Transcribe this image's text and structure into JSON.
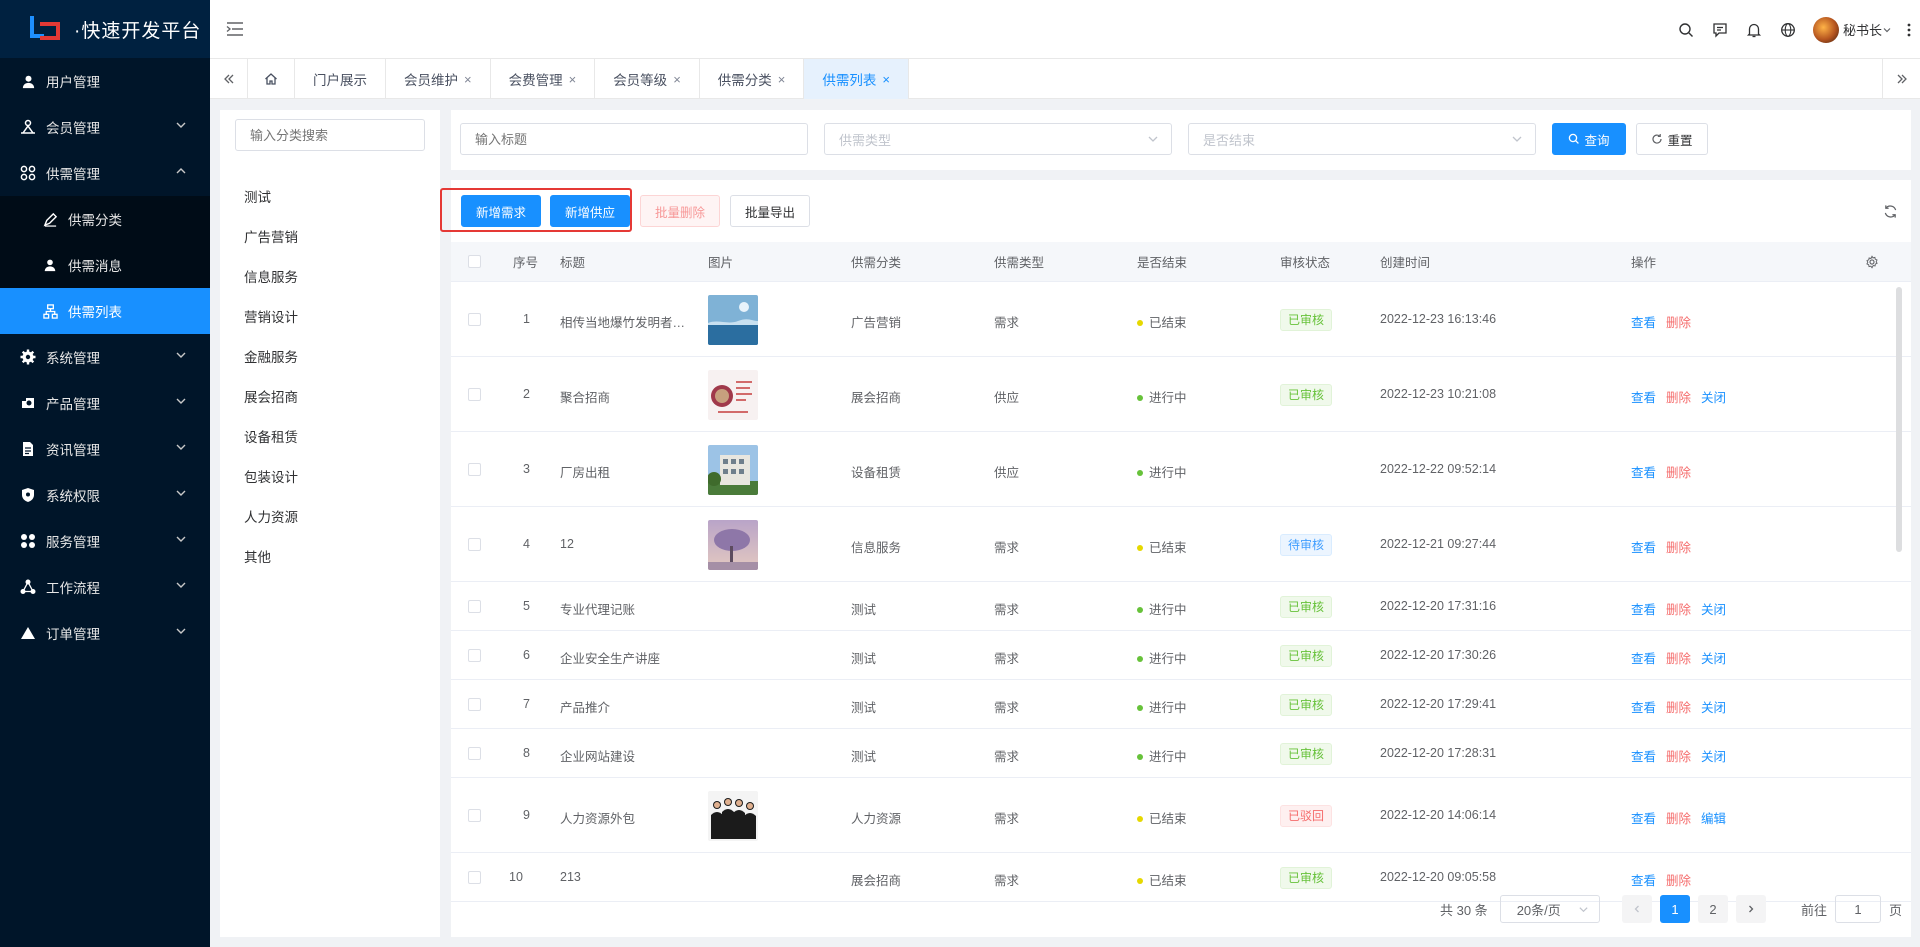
{
  "app": {
    "title": "·快速开发平台"
  },
  "sidebar": {
    "items": [
      {
        "label": "用户管理",
        "icon": "user-icon",
        "has_children": false
      },
      {
        "label": "会员管理",
        "icon": "members-icon",
        "has_children": true
      },
      {
        "label": "供需管理",
        "icon": "apps-icon",
        "has_children": true,
        "expanded": true,
        "children": [
          {
            "label": "供需分类",
            "icon": "edit-icon"
          },
          {
            "label": "供需消息",
            "icon": "user-icon"
          },
          {
            "label": "供需列表",
            "icon": "hierarchy-icon",
            "active": true
          }
        ]
      },
      {
        "label": "系统管理",
        "icon": "gear-icon",
        "has_children": true
      },
      {
        "label": "产品管理",
        "icon": "product-icon",
        "has_children": true
      },
      {
        "label": "资讯管理",
        "icon": "document-icon",
        "has_children": true
      },
      {
        "label": "系统权限",
        "icon": "shield-icon",
        "has_children": true
      },
      {
        "label": "服务管理",
        "icon": "apps-icon",
        "has_children": true
      },
      {
        "label": "工作流程",
        "icon": "workflow-icon",
        "has_children": true
      },
      {
        "label": "订单管理",
        "icon": "triangle-icon",
        "has_children": true
      }
    ]
  },
  "header": {
    "user_name": "秘书长"
  },
  "tabs": [
    {
      "label": "门户展示",
      "closable": false
    },
    {
      "label": "会员维护",
      "closable": true
    },
    {
      "label": "会费管理",
      "closable": true
    },
    {
      "label": "会员等级",
      "closable": true
    },
    {
      "label": "供需分类",
      "closable": true
    },
    {
      "label": "供需列表",
      "closable": true,
      "active": true
    }
  ],
  "category_panel": {
    "search_placeholder": "输入分类搜索",
    "categories": [
      "测试",
      "广告营销",
      "信息服务",
      "营销设计",
      "金融服务",
      "展会招商",
      "设备租赁",
      "包装设计",
      "人力资源",
      "其他"
    ]
  },
  "filters": {
    "title_placeholder": "输入标题",
    "type_placeholder": "供需类型",
    "finished_placeholder": "是否结束",
    "query_label": "查询",
    "reset_label": "重置"
  },
  "toolbar": {
    "add_demand": "新增需求",
    "add_supply": "新增供应",
    "batch_delete": "批量删除",
    "batch_export": "批量导出"
  },
  "table": {
    "columns": [
      "序号",
      "标题",
      "图片",
      "供需分类",
      "供需类型",
      "是否结束",
      "审核状态",
      "创建时间",
      "操作"
    ],
    "rows": [
      {
        "no": "1",
        "title": "相传当地爆竹发明者…",
        "image": "sea",
        "category": "广告营销",
        "type": "需求",
        "finished": "已结束",
        "audit": "已审核",
        "audit_kind": "success",
        "created": "2022-12-23 16:13:46",
        "ops": [
          "查看",
          "删除"
        ]
      },
      {
        "no": "2",
        "title": "聚合招商",
        "image": "poster",
        "category": "展会招商",
        "type": "供应",
        "finished": "进行中",
        "audit": "已审核",
        "audit_kind": "success",
        "created": "2022-12-23 10:21:08",
        "ops": [
          "查看",
          "删除",
          "关闭"
        ]
      },
      {
        "no": "3",
        "title": "厂房出租",
        "image": "building",
        "category": "设备租赁",
        "type": "供应",
        "finished": "进行中",
        "audit": "",
        "audit_kind": "",
        "created": "2022-12-22 09:52:14",
        "ops": [
          "查看",
          "删除"
        ]
      },
      {
        "no": "4",
        "title": "12",
        "image": "tree",
        "category": "信息服务",
        "type": "需求",
        "finished": "已结束",
        "audit": "待审核",
        "audit_kind": "info",
        "created": "2022-12-21 09:27:44",
        "ops": [
          "查看",
          "删除"
        ]
      },
      {
        "no": "5",
        "title": "专业代理记账",
        "image": "",
        "category": "测试",
        "type": "需求",
        "finished": "进行中",
        "audit": "已审核",
        "audit_kind": "success",
        "created": "2022-12-20 17:31:16",
        "ops": [
          "查看",
          "删除",
          "关闭"
        ]
      },
      {
        "no": "6",
        "title": "企业安全生产讲座",
        "image": "",
        "category": "测试",
        "type": "需求",
        "finished": "进行中",
        "audit": "已审核",
        "audit_kind": "success",
        "created": "2022-12-20 17:30:26",
        "ops": [
          "查看",
          "删除",
          "关闭"
        ]
      },
      {
        "no": "7",
        "title": "产品推介",
        "image": "",
        "category": "测试",
        "type": "需求",
        "finished": "进行中",
        "audit": "已审核",
        "audit_kind": "success",
        "created": "2022-12-20 17:29:41",
        "ops": [
          "查看",
          "删除",
          "关闭"
        ]
      },
      {
        "no": "8",
        "title": "企业网站建设",
        "image": "",
        "category": "测试",
        "type": "需求",
        "finished": "进行中",
        "audit": "已审核",
        "audit_kind": "success",
        "created": "2022-12-20 17:28:31",
        "ops": [
          "查看",
          "删除",
          "关闭"
        ]
      },
      {
        "no": "9",
        "title": "人力资源外包",
        "image": "people",
        "category": "人力资源",
        "type": "需求",
        "finished": "已结束",
        "audit": "已驳回",
        "audit_kind": "danger",
        "created": "2022-12-20 14:06:14",
        "ops": [
          "查看",
          "删除",
          "编辑"
        ]
      },
      {
        "no": "10",
        "title": "213",
        "image": "",
        "category": "展会招商",
        "type": "需求",
        "finished": "已结束",
        "audit": "已审核",
        "audit_kind": "success",
        "created": "2022-12-20 09:05:58",
        "ops": [
          "查看",
          "删除"
        ]
      }
    ]
  },
  "pagination": {
    "total_text": "共 30 条",
    "page_size": "20条/页",
    "pages": [
      "1",
      "2"
    ],
    "current": "1",
    "goto_label": "前往",
    "goto_value": "1",
    "page_unit": "页"
  },
  "colors": {
    "primary": "#1890ff",
    "sidebar_bg": "#001529",
    "finished_dot": "#e6d800",
    "ongoing_dot": "#67c23a",
    "highlight_border": "#e53935"
  }
}
